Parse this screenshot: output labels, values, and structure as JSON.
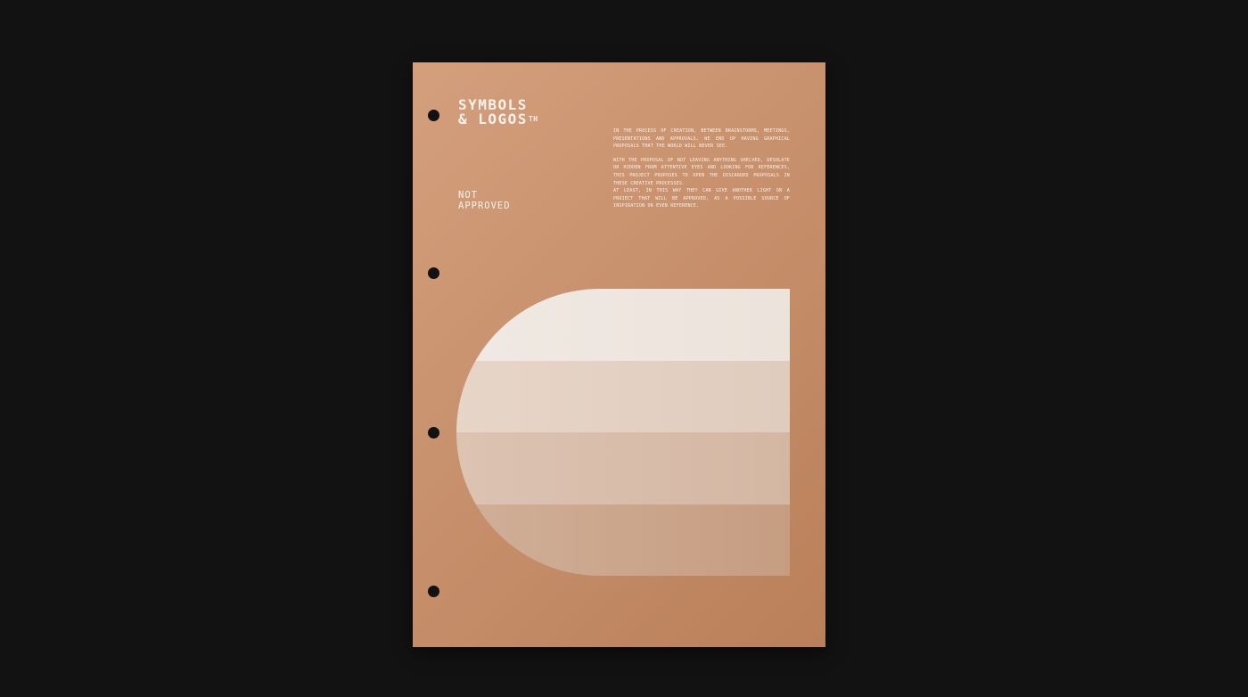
{
  "colors": {
    "background": "#121212",
    "paper": "#c8916d",
    "ink": "#fbf2ea",
    "bands": [
      "#ece3db",
      "#e0ccbd",
      "#d4b7a3",
      "#c69d81"
    ]
  },
  "brand": {
    "line1": "SYMBOLS",
    "line2": "& LOGOS",
    "mark": "TH"
  },
  "status": {
    "line1": "NOT",
    "line2": "APPROVED"
  },
  "body": {
    "paragraph1": "IN THE PROCESS OF CREATION, BETWEEN BRAINSTORMS, MEETINGS, PRESENTATIONS AND APPROVALS, WE END UP HAVING GRAPHICAL PROPOSALS THAT THE WORLD WILL NEVER SEE.",
    "paragraph2": "WITH THE PROPOSAL OF NOT LEAVING ANYTHING SHELVED, DESOLATE OR HIDDEN FROM ATTENTIVE EYES AND LOOKING FOR REFERENCES, THIS PROJECT PROPOSES TO OPEN THE DISCARDED PROPOSALS IN THESE CREATIVE PROCESSES.",
    "paragraph3": "AT LEAST, IN THIS WAY THEY CAN GIVE ANOTHER LIGHT ON A PROJECT THAT WILL BE APPROVED, AS A POSSIBLE SOURCE OF INSPIRATION OR EVEN REFERENCE."
  }
}
